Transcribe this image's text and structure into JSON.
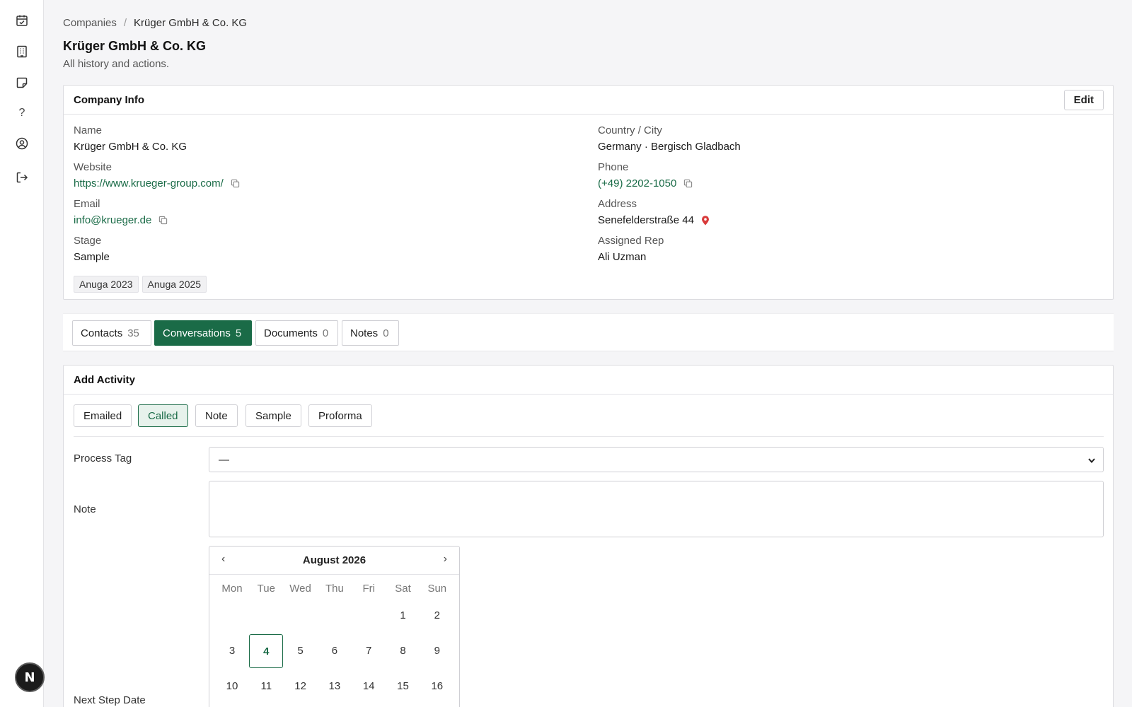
{
  "sidebar": {
    "icons": [
      "calendar-check-icon",
      "building-icon",
      "sticky-note-icon",
      "help-icon",
      "user-circle-icon",
      "logout-icon"
    ],
    "help_glyph": "?",
    "badge": "N"
  },
  "breadcrumb": {
    "parent": "Companies",
    "separator": "/",
    "current": "Krüger GmbH & Co. KG"
  },
  "header": {
    "title": "Krüger GmbH & Co. KG",
    "subtitle": "All history and actions."
  },
  "company_info": {
    "title": "Company Info",
    "edit_label": "Edit",
    "fields": {
      "name": {
        "label": "Name",
        "value": "Krüger GmbH & Co. KG"
      },
      "website": {
        "label": "Website",
        "value": "https://www.krueger-group.com/"
      },
      "email": {
        "label": "Email",
        "value": "info@krueger.de"
      },
      "stage": {
        "label": "Stage",
        "value": "Sample"
      },
      "country_city": {
        "label": "Country / City",
        "value": "Germany · Bergisch Gladbach"
      },
      "phone": {
        "label": "Phone",
        "value": "(+49) 2202-1050"
      },
      "address": {
        "label": "Address",
        "value": "Senefelderstraße 44"
      },
      "assigned_rep": {
        "label": "Assigned Rep",
        "value": "Ali Uzman"
      }
    },
    "tags": [
      "Anuga 2023",
      "Anuga 2025"
    ]
  },
  "tabs": [
    {
      "label": "Contacts",
      "count": "35",
      "active": false
    },
    {
      "label": "Conversations",
      "count": "5",
      "active": true
    },
    {
      "label": "Documents",
      "count": "0",
      "active": false
    },
    {
      "label": "Notes",
      "count": "0",
      "active": false
    }
  ],
  "add_activity": {
    "title": "Add Activity",
    "types": [
      {
        "label": "Emailed",
        "selected": false
      },
      {
        "label": "Called",
        "selected": true
      },
      {
        "label": "Note",
        "selected": false
      },
      {
        "label": "Sample",
        "selected": false
      },
      {
        "label": "Proforma",
        "selected": false
      }
    ],
    "process_tag_label": "Process Tag",
    "process_tag_value": "—",
    "note_label": "Note",
    "note_value": "",
    "next_step_label": "Next Step Date"
  },
  "calendar": {
    "month_label": "August 2026",
    "prev": "‹",
    "next": "›",
    "weekdays": [
      "Mon",
      "Tue",
      "Wed",
      "Thu",
      "Fri",
      "Sat",
      "Sun"
    ],
    "first_weekday_index": 5,
    "visible_days": [
      1,
      2,
      3,
      4,
      5,
      6,
      7,
      8,
      9,
      10,
      11,
      12,
      13,
      14,
      15,
      16
    ],
    "selected_day": 4
  },
  "colors": {
    "accent": "#1a6b47",
    "accent_light": "#e7f2ec",
    "pin": "#d93a3a"
  }
}
